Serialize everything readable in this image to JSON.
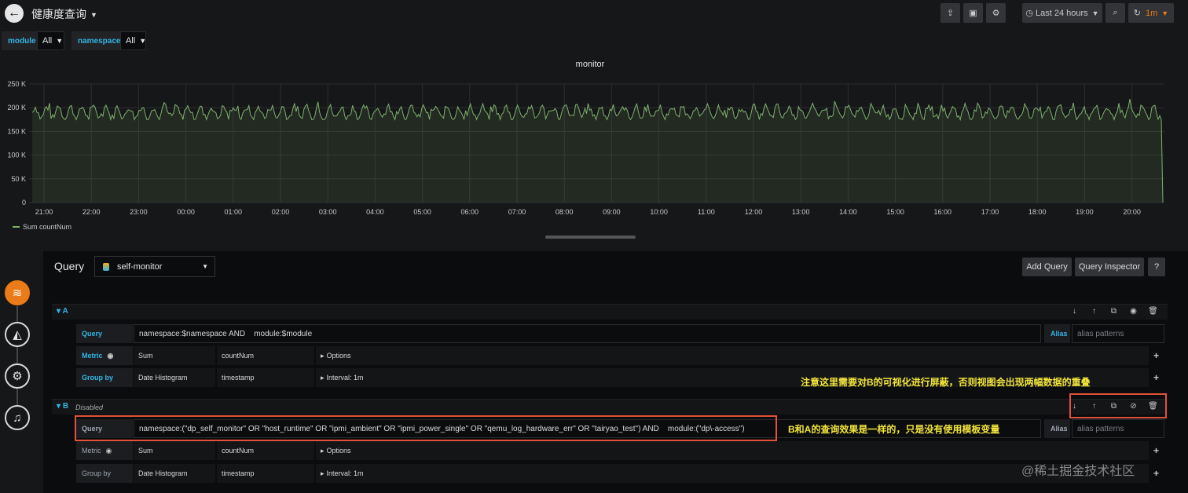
{
  "header": {
    "dashboard_title": "健康度查询",
    "time_range": "Last 24 hours",
    "refresh_interval": "1m",
    "icons": [
      "back-arrow-icon",
      "share-icon",
      "save-icon",
      "gear-icon",
      "clock-icon",
      "zoom-out-icon",
      "refresh-icon"
    ]
  },
  "variables": [
    {
      "name": "module",
      "value": "All"
    },
    {
      "name": "namespace",
      "value": "All"
    }
  ],
  "panel": {
    "title": "monitor",
    "legend": "Sum countNum"
  },
  "chart_data": {
    "type": "area",
    "title": "monitor",
    "x": [
      "21:00",
      "22:00",
      "23:00",
      "00:00",
      "01:00",
      "02:00",
      "03:00",
      "04:00",
      "05:00",
      "06:00",
      "07:00",
      "08:00",
      "09:00",
      "10:00",
      "11:00",
      "12:00",
      "13:00",
      "14:00",
      "15:00",
      "16:00",
      "17:00",
      "18:00",
      "19:00",
      "20:00"
    ],
    "y_ticks": [
      "0",
      "50 K",
      "100 K",
      "150 K",
      "200 K",
      "250 K"
    ],
    "ylim": [
      0,
      250000
    ],
    "series": [
      {
        "name": "Sum countNum",
        "color": "#7eb26d",
        "baseline_approx": 190000,
        "peak_approx": 215000,
        "low_approx": 175000,
        "pattern": "periodic oscillation with ~15 min period; drops to 0 at the right edge"
      }
    ],
    "grid": true,
    "legend_position": "bottom-left"
  },
  "editor": {
    "title": "Query",
    "datasource": "self-monitor",
    "add_query": "Add Query",
    "query_inspector": "Query Inspector",
    "help": "?",
    "queries": [
      {
        "letter": "A",
        "disabled_label": "",
        "query_label": "Query",
        "query": "namespace:$namespace AND    module:$module",
        "alias_label": "Alias",
        "alias_placeholder": "alias patterns",
        "metric_label": "Metric",
        "metric_agg": "Sum",
        "metric_field": "countNum",
        "options": "Options",
        "groupby_label": "Group by",
        "groupby_type": "Date Histogram",
        "groupby_field": "timestamp",
        "interval": "Interval: 1m"
      },
      {
        "letter": "B",
        "disabled_label": "Disabled",
        "query_label": "Query",
        "query": "namespace:(\"dp_self_monitor\" OR \"host_runtime\" OR \"ipmi_ambient\" OR \"ipmi_power_single\" OR \"qemu_log_hardware_err\" OR \"tairyao_test\") AND    module:(\"dp\\-access\")",
        "alias_label": "Alias",
        "alias_placeholder": "alias patterns",
        "metric_label": "Metric",
        "metric_agg": "Sum",
        "metric_field": "countNum",
        "options": "Options",
        "groupby_label": "Group by",
        "groupby_type": "Date Histogram",
        "groupby_field": "timestamp",
        "interval": "Interval: 1m"
      }
    ]
  },
  "annotations": {
    "note_disable": "注意这里需要对B的可视化进行屏蔽，否则视图会出现两幅数据的重叠",
    "note_same": "B和A的查询效果是一样的，只是没有使用模板变量"
  },
  "watermark": "@稀土掘金技术社区"
}
